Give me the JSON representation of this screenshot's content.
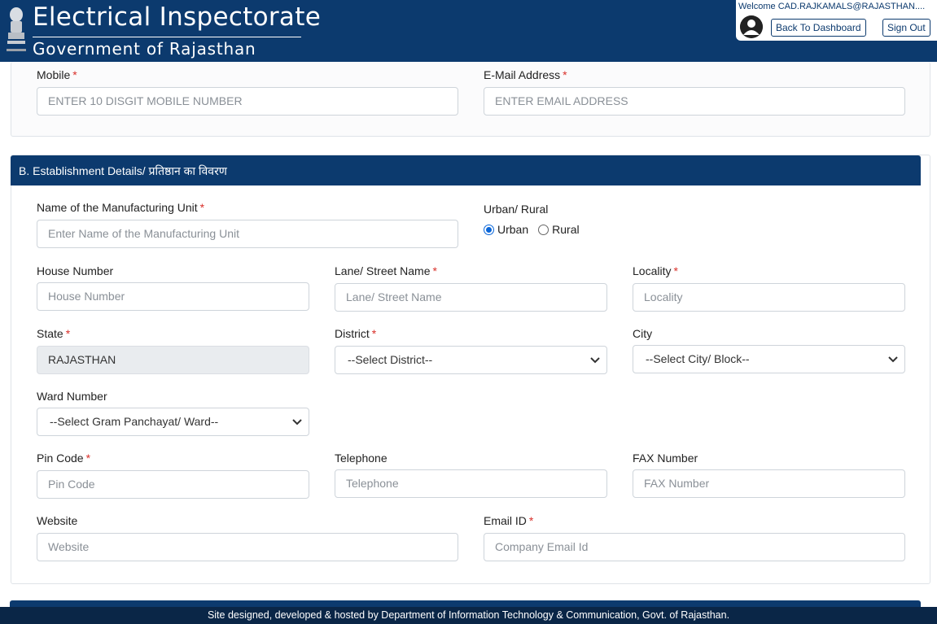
{
  "header": {
    "title": "Electrical Inspectorate",
    "subtitle": "Government of Rajasthan",
    "welcome": "Welcome CAD.RAJKAMALS@RAJASTHAN....",
    "dashboard_label": "Back To Dashboard",
    "signout_label": "Sign Out"
  },
  "contact": {
    "mobile_label": "Mobile",
    "mobile_placeholder": "ENTER 10 DISGIT MOBILE NUMBER",
    "email_label": "E-Mail Address",
    "email_placeholder": "ENTER EMAIL ADDRESS"
  },
  "establishment": {
    "heading": "B. Establishment Details/ प्रतिष्ठान का विवरण",
    "unit_name_label": "Name of the Manufacturing Unit",
    "unit_name_placeholder": "Enter Name of the Manufacturing Unit",
    "area_label": "Urban/ Rural",
    "area_options": [
      "Urban",
      "Rural"
    ],
    "area_selected": "Urban",
    "house_label": "House Number",
    "house_placeholder": "House Number",
    "street_label": "Lane/ Street Name",
    "street_placeholder": "Lane/ Street Name",
    "locality_label": "Locality",
    "locality_placeholder": "Locality",
    "state_label": "State",
    "state_value": "RAJASTHAN",
    "district_label": "District",
    "district_value": "--Select District--",
    "city_label": "City",
    "city_value": "--Select City/ Block--",
    "ward_label": "Ward Number",
    "ward_value": "--Select Gram Panchayat/ Ward--",
    "pin_label": "Pin Code",
    "pin_placeholder": "Pin Code",
    "telephone_label": "Telephone",
    "telephone_placeholder": "Telephone",
    "fax_label": "FAX Number",
    "fax_placeholder": "FAX Number",
    "website_label": "Website",
    "website_placeholder": "Website",
    "email_id_label": "Email ID",
    "email_id_placeholder": "Company Email Id"
  },
  "footer": {
    "text": "Site designed, developed & hosted by Department of Information Technology & Communication, Govt. of Rajasthan."
  },
  "colors": {
    "primary": "#0c3a6e",
    "required": "#d9302a",
    "radio_accent": "#0a66d8"
  },
  "icons": {
    "emblem": "state-emblem-icon",
    "avatar": "user-avatar-icon",
    "select_arrow": "chevron-down-icon"
  }
}
